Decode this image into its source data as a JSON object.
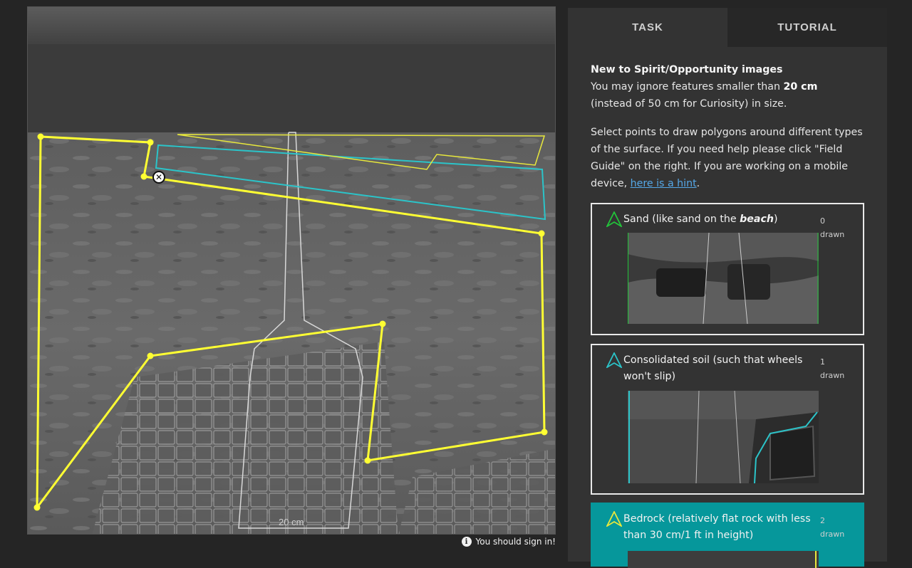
{
  "tabs": {
    "task": "TASK",
    "tutorial": "TUTORIAL"
  },
  "intro": {
    "title": "New to Spirit/Opportunity images",
    "line1_prefix": "You may ignore features smaller than ",
    "line1_bold": "20 cm",
    "line2": "(instead of 50 cm for Curiosity) in size."
  },
  "instructions": {
    "text": "Select points to draw polygons around different types of the surface. If you need help please click \"Field Guide\" on the right. If you are working on a mobile device, ",
    "link": "here is a hint",
    "tail": "."
  },
  "choices": [
    {
      "label_prefix": "Sand (like sand on the ",
      "label_bold": "beach",
      "label_suffix": ")",
      "count": "0",
      "count_label": "drawn",
      "color": "#22c33a",
      "icon": "sand-arrow-icon"
    },
    {
      "label_prefix": "Consolidated soil (such that wheels won't slip)",
      "label_bold": "",
      "label_suffix": "",
      "count": "1",
      "count_label": "drawn",
      "color": "#2bc4c9",
      "icon": "soil-arrow-icon"
    },
    {
      "label_prefix": "Bedrock (relatively flat rock with less than 30 cm/1 ft in height)",
      "label_bold": "",
      "label_suffix": "",
      "count": "2",
      "count_label": "drawn",
      "color": "#e8e83c",
      "icon": "bedrock-arrow-icon"
    }
  ],
  "image": {
    "scale_label": "20 cm"
  },
  "signin": {
    "text": "You should sign in!",
    "icon": "info-icon"
  },
  "colors": {
    "sand": "#22c33a",
    "soil": "#2bc4c9",
    "bedrock": "#ffff33",
    "accent": "#06979b"
  }
}
